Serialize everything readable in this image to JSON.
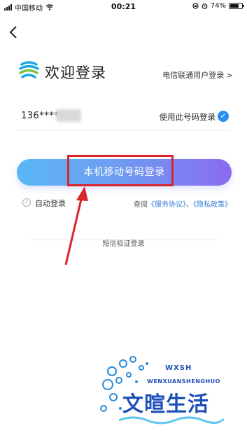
{
  "status_bar": {
    "carrier": "中国移动",
    "time": "00:21",
    "battery": "74%",
    "battery_level": 0.74
  },
  "header": {
    "back_icon": "chevron-left-icon",
    "title": "欢迎登录",
    "telecom_link": "电信联通用户登录 >"
  },
  "account": {
    "phone_masked": "136****",
    "use_number_label": "使用此号码登录"
  },
  "login_button": {
    "label": "本机移动号码登录"
  },
  "agreement": {
    "auto_login_label": "自动登录",
    "prefix": "查阅",
    "service_link": "《服务协议》",
    "separator": "、",
    "privacy_link": "《隐私政策》"
  },
  "sms_login": {
    "label": "短信验证登录"
  },
  "watermark": {
    "main": "文暄生活",
    "small": "WXSH",
    "sub": "WENXUANSHENGHUO"
  },
  "colors": {
    "accent_blue": "#2d8cf0",
    "button_start": "#5ab8f5",
    "button_end": "#8a6bf0",
    "highlight_red": "#d9262c",
    "link_blue": "#3a7fd8"
  }
}
